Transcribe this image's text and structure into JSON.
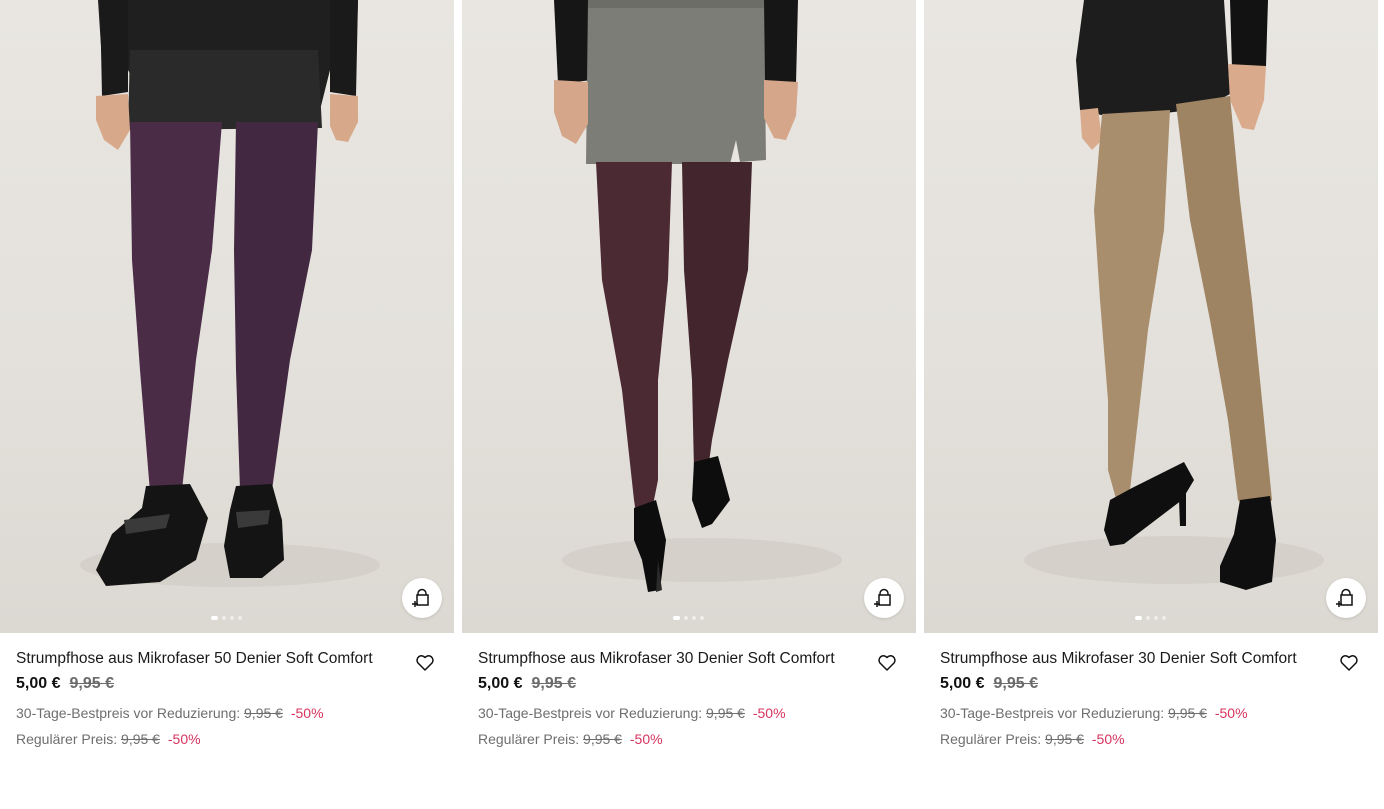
{
  "products": [
    {
      "title": "Strumpfhose aus Mikrofaser 50 Denier Soft Comfort",
      "price_current": "5,00 €",
      "price_old": "9,95 €",
      "best_price_label": "30-Tage-Bestpreis vor Reduzierung:",
      "best_price_value": "9,95 €",
      "best_price_discount": "-50%",
      "regular_label": "Regulärer Preis:",
      "regular_value": "9,95 €",
      "regular_discount": "-50%",
      "image_slides": 4,
      "active_slide": 1,
      "hosiery_color": "#4a2c46",
      "outfit": "black-blazer-shorts-loafers"
    },
    {
      "title": "Strumpfhose aus Mikrofaser 30 Denier Soft Comfort",
      "price_current": "5,00 €",
      "price_old": "9,95 €",
      "best_price_label": "30-Tage-Bestpreis vor Reduzierung:",
      "best_price_value": "9,95 €",
      "best_price_discount": "-50%",
      "regular_label": "Regulärer Preis:",
      "regular_value": "9,95 €",
      "regular_discount": "-50%",
      "image_slides": 4,
      "active_slide": 1,
      "hosiery_color": "#4b2a34",
      "outfit": "grey-skirt-black-pumps"
    },
    {
      "title": "Strumpfhose aus Mikrofaser 30 Denier Soft Comfort",
      "price_current": "5,00 €",
      "price_old": "9,95 €",
      "best_price_label": "30-Tage-Bestpreis vor Reduzierung:",
      "best_price_value": "9,95 €",
      "best_price_discount": "-50%",
      "regular_label": "Regulärer Preis:",
      "regular_value": "9,95 €",
      "regular_discount": "-50%",
      "image_slides": 4,
      "active_slide": 1,
      "hosiery_color": "#a88e6c",
      "outfit": "black-skort-black-heels"
    }
  ],
  "icons": {
    "quick_add": "bag-plus-icon",
    "wishlist": "heart-icon"
  },
  "colors": {
    "discount": "#d6335e",
    "text": "#1a1a1a",
    "muted": "#6e6e6e"
  }
}
